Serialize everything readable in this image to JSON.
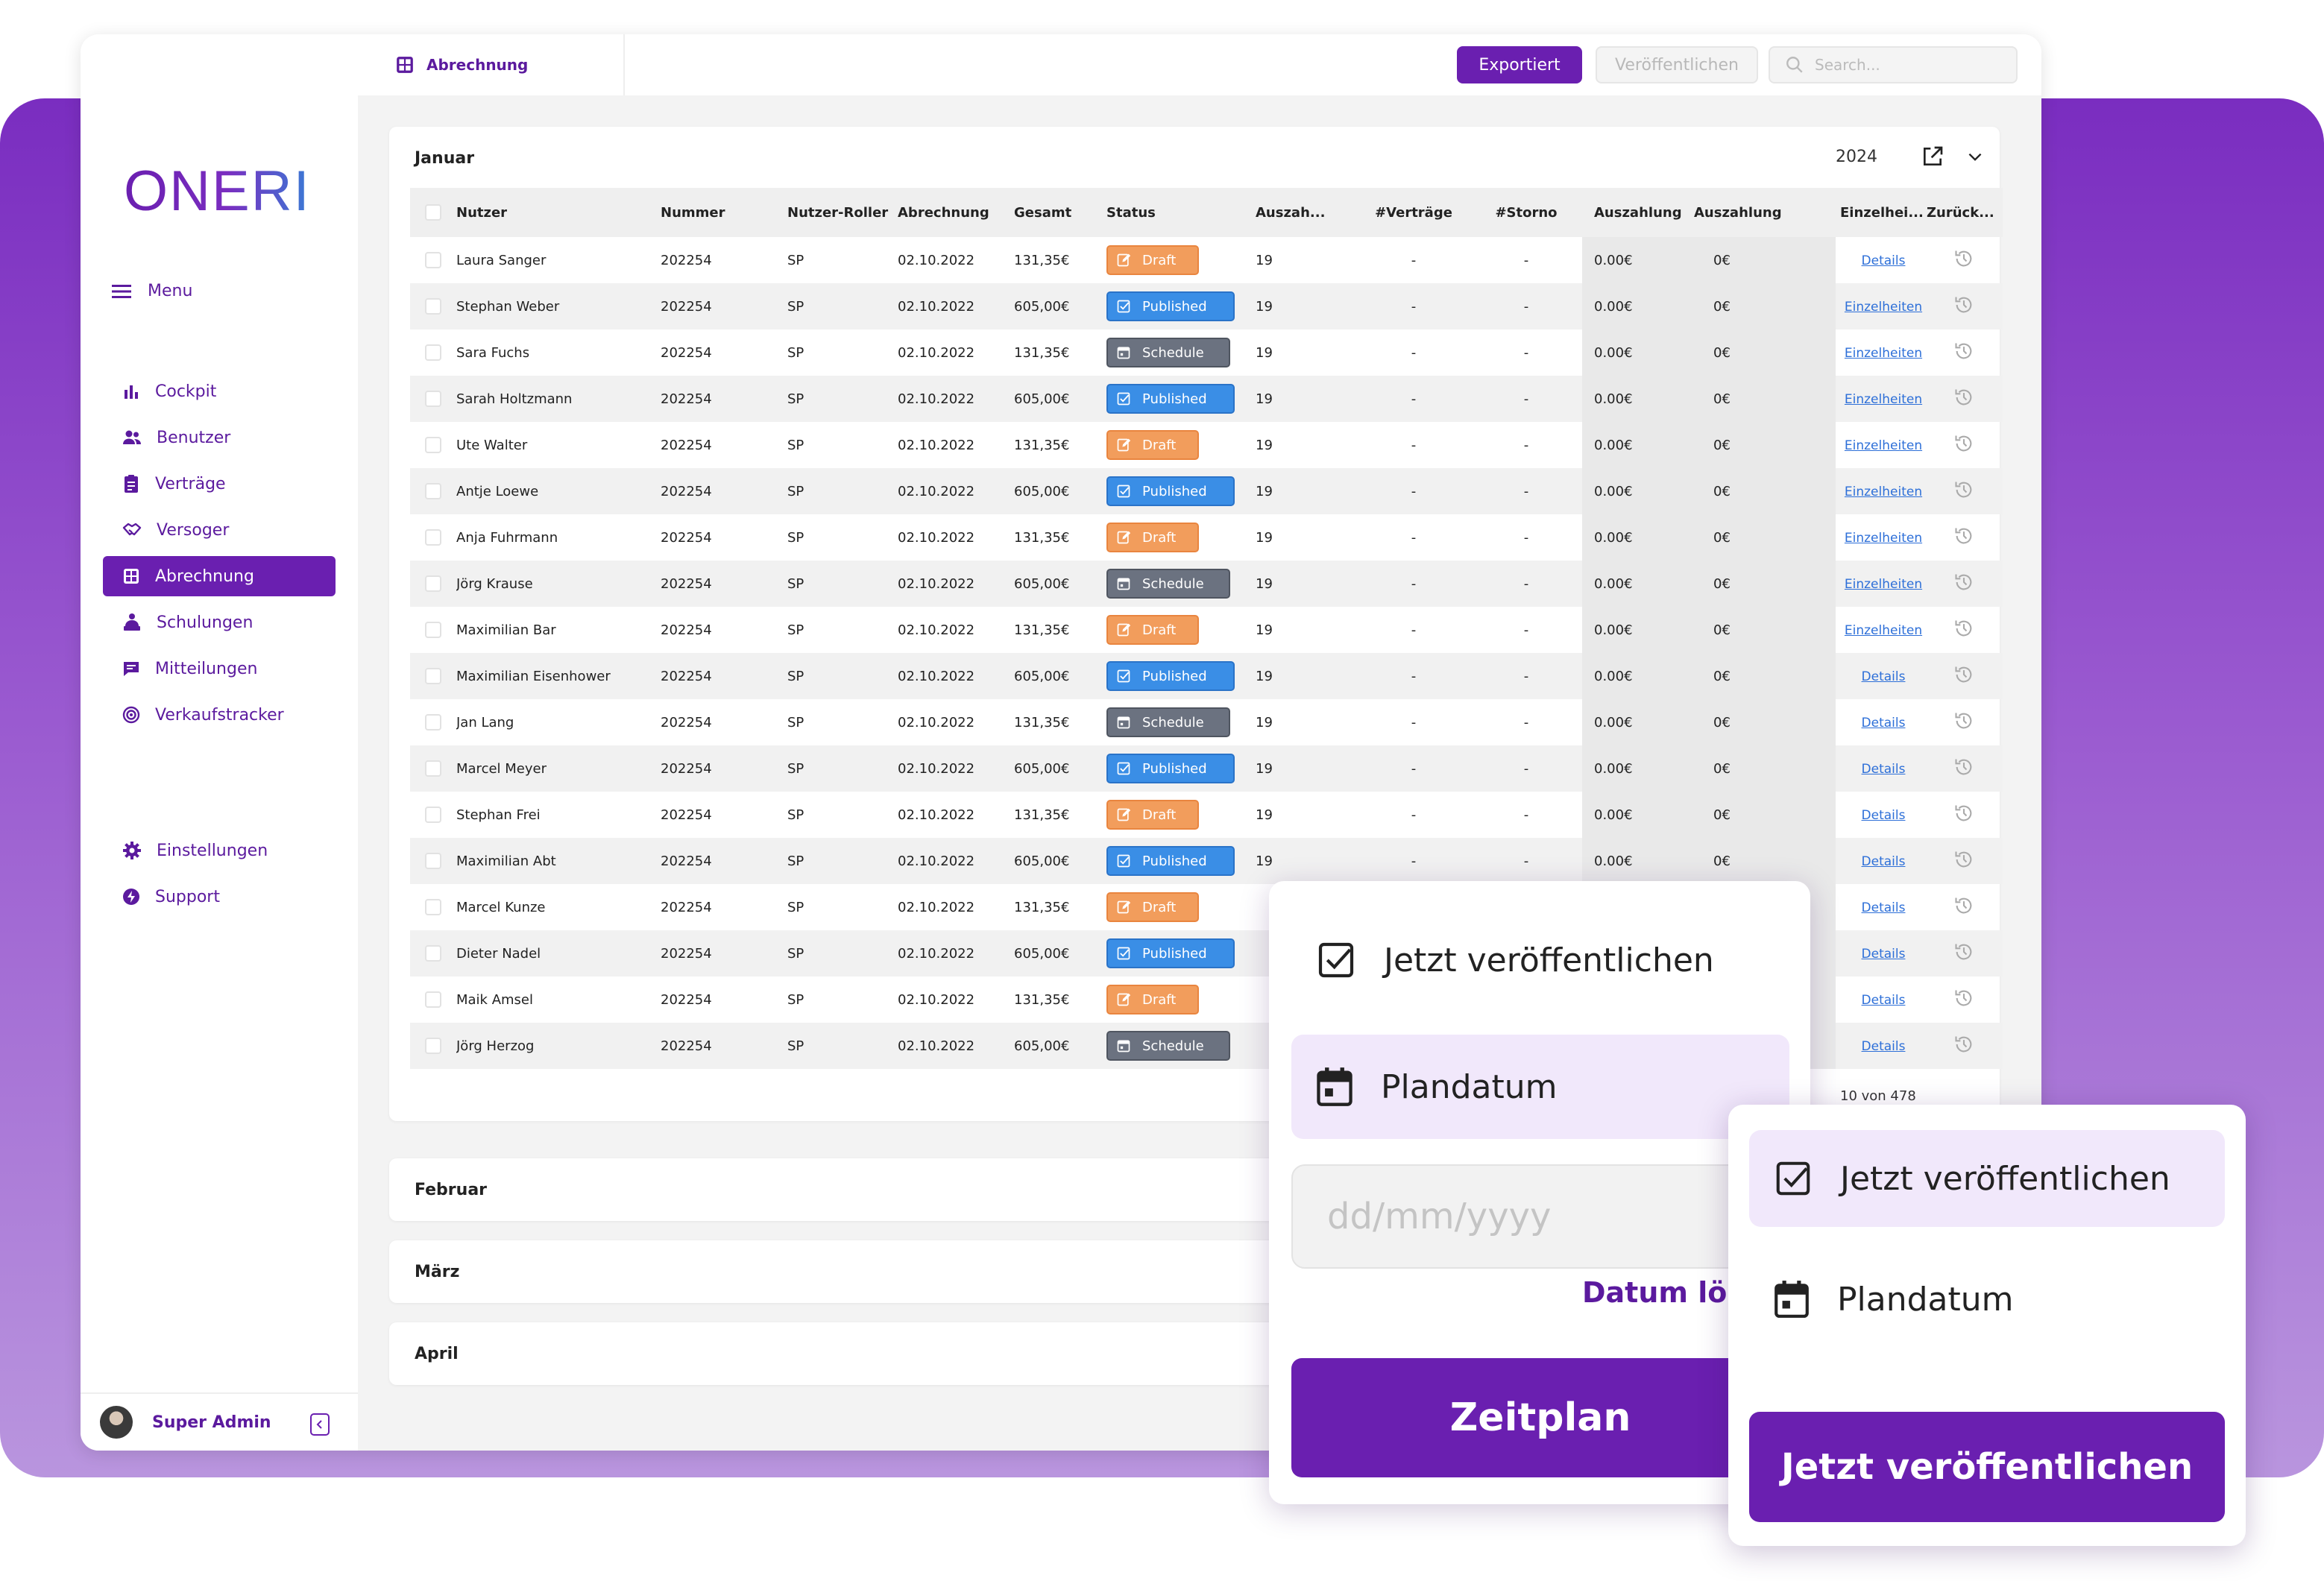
{
  "app": {
    "brand": "ONERI"
  },
  "topbar": {
    "tab_label": "Abrechnung",
    "export_label": "Exportiert",
    "publish_label": "Veröffentlichen",
    "search_placeholder": "Search..."
  },
  "sidebar": {
    "menu_label": "Menu",
    "items": [
      {
        "label": "Cockpit",
        "icon": "bar-chart-icon"
      },
      {
        "label": "Benutzer",
        "icon": "users-icon"
      },
      {
        "label": "Verträge",
        "icon": "clipboard-icon"
      },
      {
        "label": "Versoger",
        "icon": "handshake-icon"
      },
      {
        "label": "Abrechnung",
        "icon": "calculator-icon",
        "active": true
      },
      {
        "label": "Schulungen",
        "icon": "training-icon"
      },
      {
        "label": "Mitteilungen",
        "icon": "message-icon"
      },
      {
        "label": "Verkaufstracker",
        "icon": "target-icon"
      }
    ],
    "bottom_items": [
      {
        "label": "Einstellungen",
        "icon": "gear-icon"
      },
      {
        "label": "Support",
        "icon": "bolt-icon"
      }
    ],
    "user_name": "Super Admin"
  },
  "panel": {
    "title": "Januar",
    "year": "2024",
    "pagination": "10 von 478"
  },
  "table": {
    "headers": [
      "Nutzer",
      "Nummer",
      "Nutzer-Roller",
      "Abrechnung",
      "Gesamt",
      "Status",
      "Auszah...",
      "#Verträge",
      "#Storno",
      "Auszahlung",
      "Auszahlung",
      "Einzelhei...",
      "Zurück..."
    ],
    "rows": [
      {
        "name": "Laura Sanger",
        "num": "202254",
        "role": "SP",
        "date": "02.10.2022",
        "total": "131,35€",
        "status": "Draft",
        "ausz": "19",
        "vert": "-",
        "storno": "-",
        "aus1": "0.00€",
        "aus2": "0€",
        "det": "Details"
      },
      {
        "name": "Stephan Weber",
        "num": "202254",
        "role": "SP",
        "date": "02.10.2022",
        "total": "605,00€",
        "status": "Published",
        "ausz": "19",
        "vert": "-",
        "storno": "-",
        "aus1": "0.00€",
        "aus2": "0€",
        "det": "Einzelheiten"
      },
      {
        "name": "Sara Fuchs",
        "num": "202254",
        "role": "SP",
        "date": "02.10.2022",
        "total": "131,35€",
        "status": "Schedule",
        "ausz": "19",
        "vert": "-",
        "storno": "-",
        "aus1": "0.00€",
        "aus2": "0€",
        "det": "Einzelheiten"
      },
      {
        "name": "Sarah Holtzmann",
        "num": "202254",
        "role": "SP",
        "date": "02.10.2022",
        "total": "605,00€",
        "status": "Published",
        "ausz": "19",
        "vert": "-",
        "storno": "-",
        "aus1": "0.00€",
        "aus2": "0€",
        "det": "Einzelheiten"
      },
      {
        "name": "Ute Walter",
        "num": "202254",
        "role": "SP",
        "date": "02.10.2022",
        "total": "131,35€",
        "status": "Draft",
        "ausz": "19",
        "vert": "-",
        "storno": "-",
        "aus1": "0.00€",
        "aus2": "0€",
        "det": "Einzelheiten"
      },
      {
        "name": "Antje Loewe",
        "num": "202254",
        "role": "SP",
        "date": "02.10.2022",
        "total": "605,00€",
        "status": "Published",
        "ausz": "19",
        "vert": "-",
        "storno": "-",
        "aus1": "0.00€",
        "aus2": "0€",
        "det": "Einzelheiten"
      },
      {
        "name": "Anja Fuhrmann",
        "num": "202254",
        "role": "SP",
        "date": "02.10.2022",
        "total": "131,35€",
        "status": "Draft",
        "ausz": "19",
        "vert": "-",
        "storno": "-",
        "aus1": "0.00€",
        "aus2": "0€",
        "det": "Einzelheiten"
      },
      {
        "name": "Jörg Krause",
        "num": "202254",
        "role": "SP",
        "date": "02.10.2022",
        "total": "605,00€",
        "status": "Schedule",
        "ausz": "19",
        "vert": "-",
        "storno": "-",
        "aus1": "0.00€",
        "aus2": "0€",
        "det": "Einzelheiten"
      },
      {
        "name": "Maximilian Bar",
        "num": "202254",
        "role": "SP",
        "date": "02.10.2022",
        "total": "131,35€",
        "status": "Draft",
        "ausz": "19",
        "vert": "-",
        "storno": "-",
        "aus1": "0.00€",
        "aus2": "0€",
        "det": "Einzelheiten"
      },
      {
        "name": "Maximilian Eisenhower",
        "num": "202254",
        "role": "SP",
        "date": "02.10.2022",
        "total": "605,00€",
        "status": "Published",
        "ausz": "19",
        "vert": "-",
        "storno": "-",
        "aus1": "0.00€",
        "aus2": "0€",
        "det": "Details"
      },
      {
        "name": "Jan Lang",
        "num": "202254",
        "role": "SP",
        "date": "02.10.2022",
        "total": "131,35€",
        "status": "Schedule",
        "ausz": "19",
        "vert": "-",
        "storno": "-",
        "aus1": "0.00€",
        "aus2": "0€",
        "det": "Details"
      },
      {
        "name": "Marcel Meyer",
        "num": "202254",
        "role": "SP",
        "date": "02.10.2022",
        "total": "605,00€",
        "status": "Published",
        "ausz": "19",
        "vert": "-",
        "storno": "-",
        "aus1": "0.00€",
        "aus2": "0€",
        "det": "Details"
      },
      {
        "name": "Stephan Frei",
        "num": "202254",
        "role": "SP",
        "date": "02.10.2022",
        "total": "131,35€",
        "status": "Draft",
        "ausz": "19",
        "vert": "-",
        "storno": "-",
        "aus1": "0.00€",
        "aus2": "0€",
        "det": "Details"
      },
      {
        "name": "Maximilian Abt",
        "num": "202254",
        "role": "SP",
        "date": "02.10.2022",
        "total": "605,00€",
        "status": "Published",
        "ausz": "19",
        "vert": "-",
        "storno": "-",
        "aus1": "0.00€",
        "aus2": "0€",
        "det": "Details"
      },
      {
        "name": "Marcel Kunze",
        "num": "202254",
        "role": "SP",
        "date": "02.10.2022",
        "total": "131,35€",
        "status": "Draft",
        "ausz": "",
        "vert": "",
        "storno": "",
        "aus1": "",
        "aus2": "",
        "det": "Details"
      },
      {
        "name": "Dieter Nadel",
        "num": "202254",
        "role": "SP",
        "date": "02.10.2022",
        "total": "605,00€",
        "status": "Published",
        "ausz": "",
        "vert": "",
        "storno": "",
        "aus1": "",
        "aus2": "",
        "det": "Details"
      },
      {
        "name": "Maik Amsel",
        "num": "202254",
        "role": "SP",
        "date": "02.10.2022",
        "total": "131,35€",
        "status": "Draft",
        "ausz": "",
        "vert": "",
        "storno": "",
        "aus1": "",
        "aus2": "",
        "det": "Details"
      },
      {
        "name": "Jörg Herzog",
        "num": "202254",
        "role": "SP",
        "date": "02.10.2022",
        "total": "605,00€",
        "status": "Schedule",
        "ausz": "",
        "vert": "",
        "storno": "",
        "aus1": "",
        "aus2": "",
        "det": "Details"
      }
    ]
  },
  "months": [
    "Februar",
    "März",
    "April"
  ],
  "popup_schedule": {
    "option_now": "Jetzt veröffentlichen",
    "option_date": "Plandatum",
    "date_placeholder": "dd/mm/yyyy",
    "clear_label": "Datum löschen",
    "submit_label": "Zeitplan"
  },
  "popup_publish": {
    "option_now": "Jetzt veröffentlichen",
    "option_date": "Plandatum",
    "submit_label": "Jetzt veröffentlichen"
  },
  "colors": {
    "brand": "#6a1fb0",
    "draft": "#f29d5c",
    "published": "#3a8ee6",
    "schedule": "#6b7280",
    "link": "#2d6fd8"
  }
}
